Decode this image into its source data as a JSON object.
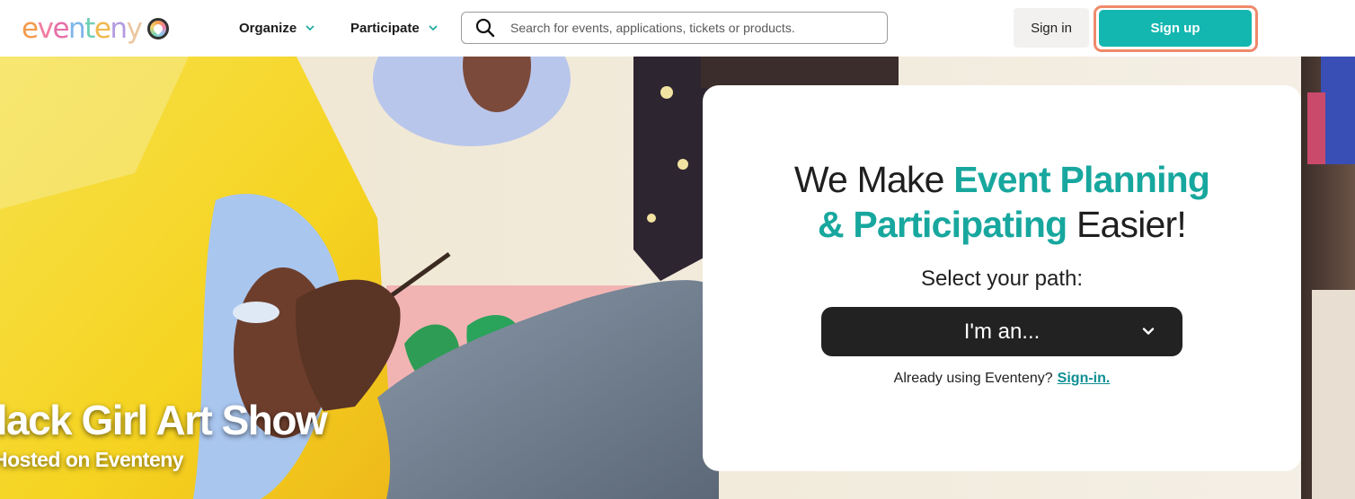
{
  "brand": {
    "name": "eventeny",
    "letters": [
      "e",
      "v",
      "e",
      "n",
      "t",
      "e",
      "n",
      "y"
    ],
    "letter_colors": [
      "#f39a4c",
      "#ef7ea0",
      "#e66fa8",
      "#7fb6e9",
      "#6fcfb4",
      "#f0b94e",
      "#b59be0",
      "#ecc6a0"
    ]
  },
  "nav": {
    "organize": "Organize",
    "participate": "Participate"
  },
  "search": {
    "placeholder": "Search for events, applications, tickets or products."
  },
  "auth": {
    "signin": "Sign in",
    "signup": "Sign up"
  },
  "hero": {
    "title": "Black Girl Art Show",
    "subtitle": "Hosted on Eventeny"
  },
  "card": {
    "headline_plain_1": "We Make ",
    "headline_accent_1": "Event Planning",
    "headline_accent_2": "& Participating",
    "headline_plain_2": " Easier!",
    "select_label": "Select your path:",
    "select_value": "I'm an...",
    "already_text": "Already using Eventeny?",
    "signin_link": "Sign-in."
  },
  "colors": {
    "accent": "#17a79e",
    "signup_bg": "#13b7b0",
    "signup_highlight": "#ef8a6b",
    "select_bg": "#222222"
  },
  "icons": {
    "search": "search-icon",
    "chevron": "chevron-down-icon",
    "logo_badge": "heart-badge-icon"
  }
}
